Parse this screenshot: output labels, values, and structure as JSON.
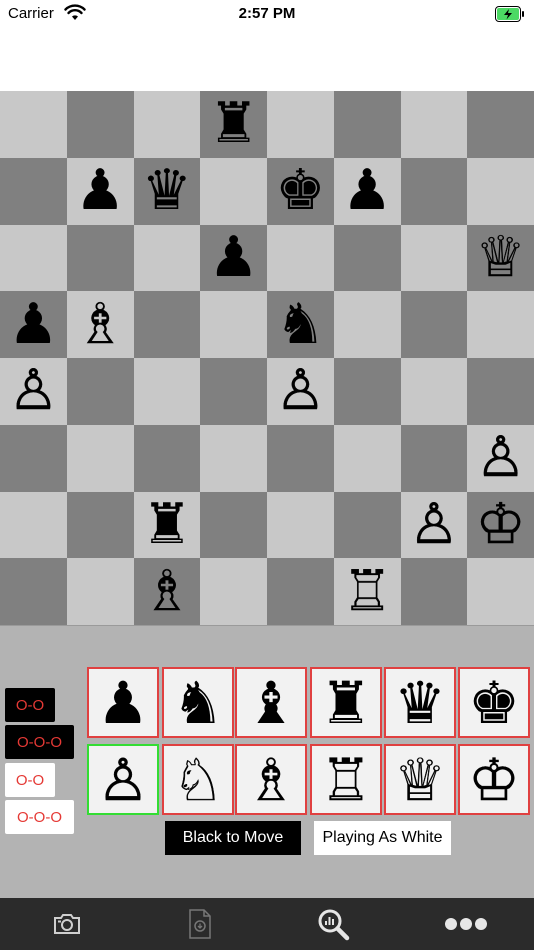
{
  "status": {
    "carrier": "Carrier",
    "time": "2:57 PM"
  },
  "board": {
    "pieces": [
      {
        "square": "d8",
        "symbol": "♜",
        "color": "black",
        "name": "black-rook"
      },
      {
        "square": "b7",
        "symbol": "♟",
        "color": "black",
        "name": "black-pawn"
      },
      {
        "square": "c7",
        "symbol": "♛",
        "color": "black",
        "name": "black-queen"
      },
      {
        "square": "e7",
        "symbol": "♚",
        "color": "black",
        "name": "black-king"
      },
      {
        "square": "f7",
        "symbol": "♟",
        "color": "black",
        "name": "black-pawn"
      },
      {
        "square": "d6",
        "symbol": "♟",
        "color": "black",
        "name": "black-pawn"
      },
      {
        "square": "h6",
        "symbol": "♕",
        "color": "white",
        "name": "white-queen"
      },
      {
        "square": "a5",
        "symbol": "♟",
        "color": "black",
        "name": "black-pawn"
      },
      {
        "square": "b5",
        "symbol": "♗",
        "color": "white",
        "name": "white-bishop"
      },
      {
        "square": "e5",
        "symbol": "♞",
        "color": "black",
        "name": "black-knight"
      },
      {
        "square": "a4",
        "symbol": "♙",
        "color": "white",
        "name": "white-pawn"
      },
      {
        "square": "e4",
        "symbol": "♙",
        "color": "white",
        "name": "white-pawn"
      },
      {
        "square": "h3",
        "symbol": "♙",
        "color": "white",
        "name": "white-pawn"
      },
      {
        "square": "c2",
        "symbol": "♜",
        "color": "black",
        "name": "black-rook"
      },
      {
        "square": "g2",
        "symbol": "♙",
        "color": "white",
        "name": "white-pawn"
      },
      {
        "square": "h2",
        "symbol": "♔",
        "color": "white",
        "name": "white-king"
      },
      {
        "square": "c1",
        "symbol": "♗",
        "color": "white",
        "name": "white-bishop"
      },
      {
        "square": "f1",
        "symbol": "♖",
        "color": "white",
        "name": "white-rook"
      }
    ]
  },
  "castling": {
    "black_short": "O-O",
    "black_long": "O-O-O",
    "white_short": "O-O",
    "white_long": "O-O-O"
  },
  "selector": {
    "black": [
      {
        "symbol": "♟",
        "name": "pawn"
      },
      {
        "symbol": "♞",
        "name": "knight"
      },
      {
        "symbol": "♝",
        "name": "bishop"
      },
      {
        "symbol": "♜",
        "name": "rook"
      },
      {
        "symbol": "♛",
        "name": "queen"
      },
      {
        "symbol": "♚",
        "name": "king"
      }
    ],
    "white": [
      {
        "symbol": "♙",
        "name": "pawn",
        "selected": true
      },
      {
        "symbol": "♘",
        "name": "knight"
      },
      {
        "symbol": "♗",
        "name": "bishop"
      },
      {
        "symbol": "♖",
        "name": "rook"
      },
      {
        "symbol": "♕",
        "name": "queen"
      },
      {
        "symbol": "♔",
        "name": "king"
      }
    ]
  },
  "labels": {
    "to_move": "Black to Move",
    "playing_as": "Playing As White"
  },
  "tabs": [
    {
      "name": "camera-tab",
      "icon": "camera-icon"
    },
    {
      "name": "document-tab",
      "icon": "document-icon"
    },
    {
      "name": "analyze-tab",
      "icon": "magnifier-icon"
    },
    {
      "name": "more-tab",
      "icon": "more-icon"
    }
  ],
  "colors": {
    "light_square": "#c8c8c8",
    "dark_square": "#808080",
    "selector_border": "#e04040",
    "selected_border": "#33dd33",
    "castle_text": "#e53935"
  }
}
